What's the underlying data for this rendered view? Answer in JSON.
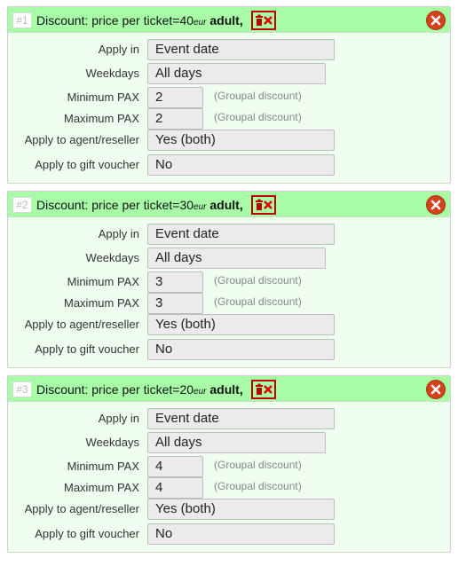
{
  "discounts": [
    {
      "number": "#1",
      "title_prefix": "Discount: price per ticket=40",
      "currency": "eur",
      "pax_type": "adult,",
      "apply_in_label": "Apply in",
      "apply_in_value": "Event date",
      "weekdays_label": "Weekdays",
      "weekdays_value": "All days",
      "min_pax_label": "Minimum PAX",
      "min_pax_value": "2",
      "min_pax_hint": "(Groupal discount)",
      "max_pax_label": "Maximum PAX",
      "max_pax_value": "2",
      "max_pax_hint": "(Groupal discount)",
      "agent_label": "Apply to agent/reseller",
      "agent_value": "Yes (both)",
      "voucher_label": "Apply to gift voucher",
      "voucher_value": "No"
    },
    {
      "number": "#2",
      "title_prefix": "Discount: price per ticket=30",
      "currency": "eur",
      "pax_type": "adult,",
      "apply_in_label": "Apply in",
      "apply_in_value": "Event date",
      "weekdays_label": "Weekdays",
      "weekdays_value": "All days",
      "min_pax_label": "Minimum PAX",
      "min_pax_value": "3",
      "min_pax_hint": "(Groupal discount)",
      "max_pax_label": "Maximum PAX",
      "max_pax_value": "3",
      "max_pax_hint": "(Groupal discount)",
      "agent_label": "Apply to agent/reseller",
      "agent_value": "Yes (both)",
      "voucher_label": "Apply to gift voucher",
      "voucher_value": "No"
    },
    {
      "number": "#3",
      "title_prefix": "Discount: price per ticket=20",
      "currency": "eur",
      "pax_type": "adult,",
      "apply_in_label": "Apply in",
      "apply_in_value": "Event date",
      "weekdays_label": "Weekdays",
      "weekdays_value": "All days",
      "min_pax_label": "Minimum PAX",
      "min_pax_value": "4",
      "min_pax_hint": "(Groupal discount)",
      "max_pax_label": "Maximum PAX",
      "max_pax_value": "4",
      "max_pax_hint": "(Groupal discount)",
      "agent_label": "Apply to agent/reseller",
      "agent_value": "Yes (both)",
      "voucher_label": "Apply to gift voucher",
      "voucher_value": "No"
    }
  ],
  "icons": {
    "delete": "trash-delete-icon",
    "close": "close-circle-icon"
  },
  "colors": {
    "header_bg": "#a8fca8",
    "card_bg": "#effeef",
    "close_red": "#d24319",
    "delete_red": "#c00000"
  }
}
